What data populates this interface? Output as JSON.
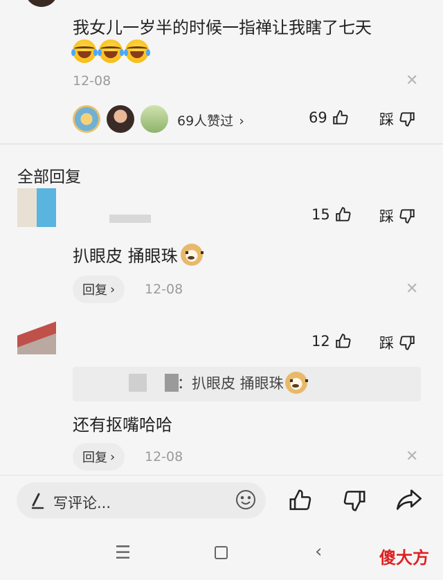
{
  "top_comment": {
    "text": "我女儿一岁半的时候一指禅让我瞎了七天",
    "emojis": [
      "laughing-crying-emoji",
      "laughing-crying-emoji",
      "laughing-crying-emoji"
    ],
    "date": "12-08",
    "likers_text": "69人赞过",
    "like_count": "69",
    "dislike_label": "踩"
  },
  "section_title": "全部回复",
  "replies": [
    {
      "like_count": "15",
      "dislike_label": "踩",
      "text": "扒眼皮 捅眼珠",
      "reply_label": "回复",
      "date": "12-08"
    },
    {
      "like_count": "12",
      "dislike_label": "踩",
      "quote_text": "：扒眼皮 捅眼珠",
      "text": "还有抠嘴哈哈",
      "reply_label": "回复",
      "date": "12-08"
    }
  ],
  "bottom": {
    "input_placeholder": "写评论..."
  },
  "watermark": "傻大方",
  "colors": {
    "background": "#f5f5f5",
    "text": "#222222",
    "muted": "#9a9a9a",
    "watermark_red": "#e02020"
  }
}
